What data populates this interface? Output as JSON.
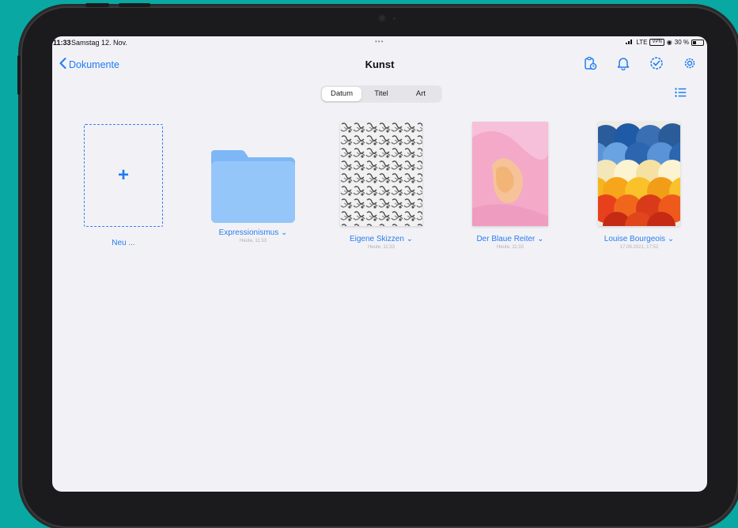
{
  "status_bar": {
    "time": "11:33",
    "date": "Samstag 12. Nov.",
    "dots": "•••",
    "network": "LTE",
    "vpn": "VPN",
    "battery": "30 %"
  },
  "nav": {
    "back_label": "Dokumente",
    "title": "Kunst"
  },
  "sort_segments": [
    {
      "label": "Datum",
      "active": true
    },
    {
      "label": "Titel",
      "active": false
    },
    {
      "label": "Art",
      "active": false
    }
  ],
  "items": [
    {
      "label": "Neu ...",
      "meta": "",
      "kind": "new"
    },
    {
      "label": "Expressionismus ⌄",
      "meta": "Heute, 11:33",
      "kind": "folder"
    },
    {
      "label": "Eigene Skizzen ⌄",
      "meta": "Heute, 11:33",
      "kind": "sketch"
    },
    {
      "label": "Der Blaue Reiter ⌄",
      "meta": "Heute, 11:33",
      "kind": "pink"
    },
    {
      "label": "Louise Bourgeois ⌄",
      "meta": "17.06.2021, 17:52",
      "kind": "scales"
    }
  ],
  "colors": {
    "accent": "#1f7cf2",
    "background": "#0aa8a3",
    "screen": "#f2f2f6",
    "folder": "#8ec2f8"
  }
}
